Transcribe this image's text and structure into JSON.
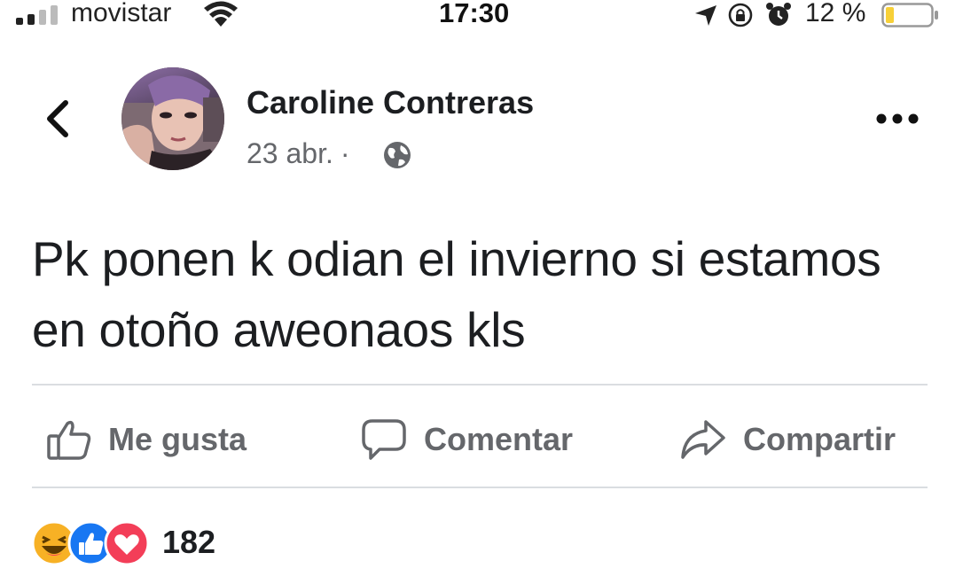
{
  "status_bar": {
    "carrier": "movistar",
    "time": "17:30",
    "battery_percent": "12 %",
    "battery_level": 0.12,
    "icons": [
      "signal-icon",
      "wifi-icon",
      "location-icon",
      "rotation-lock-icon",
      "alarm-icon",
      "battery-icon"
    ]
  },
  "post": {
    "author": "Caroline Contreras",
    "date": "23 abr.",
    "separator": "·",
    "privacy_icon": "globe-icon",
    "text": "Pk ponen k odian el invierno si estamos en otoño aweonaos kls"
  },
  "actions": {
    "like_label": "Me gusta",
    "comment_label": "Comentar",
    "share_label": "Compartir"
  },
  "reactions": {
    "types": [
      "haha",
      "like",
      "love"
    ],
    "count": "182"
  },
  "colors": {
    "text_primary": "#1c1e21",
    "text_secondary": "#65676b",
    "divider": "#dadde1",
    "like_blue": "#1877f2",
    "love_red": "#f33e58",
    "haha_yellow": "#f7b125",
    "battery_yellow": "#f7d038"
  }
}
